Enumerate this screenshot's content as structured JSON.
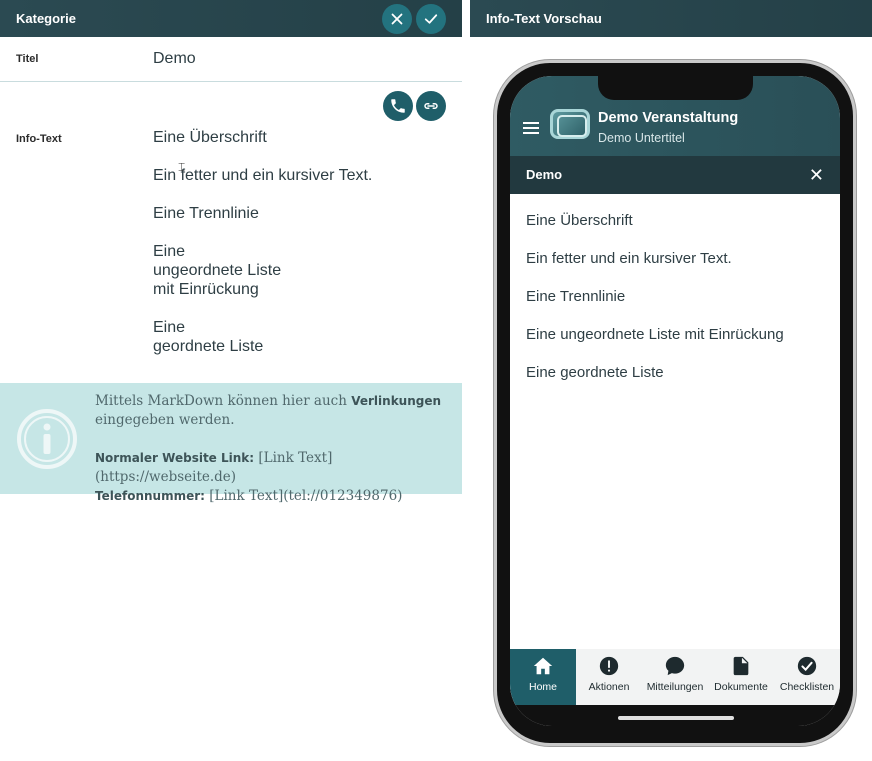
{
  "editor": {
    "header_title": "Kategorie",
    "cancel_icon": "close-icon",
    "confirm_icon": "check-icon",
    "title_label": "Titel",
    "title_value": "Demo",
    "infotext_label": "Info-Text",
    "tools": [
      "phone-icon",
      "link-icon"
    ],
    "infotext_blocks": [
      "Eine Überschrift",
      "Ein fetter und ein kursiver Text.",
      "Eine Trennlinie",
      "Eine\nungeordnete Liste\nmit Einrückung",
      "Eine\ngeordnete Liste"
    ],
    "hint": {
      "line1_pre": "Mittels MarkDown können hier auch ",
      "line1_bold": "Verlinkungen",
      "line1_post": " eingegeben werden.",
      "website_label": "Normaler Website Link:",
      "website_value": " [Link Text](https://webseite.de)",
      "phone_label": "Telefonnummer:",
      "phone_value": " [Link Text](tel://012349876)"
    }
  },
  "preview": {
    "header_title": "Info-Text Vorschau",
    "app_title": "Demo Veranstaltung",
    "app_subtitle": "Demo Untertitel",
    "section_title": "Demo",
    "close_glyph": "✕",
    "lines": [
      "Eine Überschrift",
      "Ein fetter und ein kursiver Text.",
      "Eine Trennlinie",
      "Eine ungeordnete Liste mit Einrückung",
      "Eine geordnete Liste"
    ],
    "nav": [
      {
        "label": "Home",
        "icon": "home-icon",
        "active": true
      },
      {
        "label": "Aktionen",
        "icon": "alert-icon",
        "active": false
      },
      {
        "label": "Mitteilungen",
        "icon": "chat-icon",
        "active": false
      },
      {
        "label": "Dokumente",
        "icon": "document-icon",
        "active": false
      },
      {
        "label": "Checklisten",
        "icon": "check-circle-icon",
        "active": false
      }
    ]
  },
  "colors": {
    "header": "#2b4a52",
    "accent": "#23737f",
    "hint_bg": "#c6e6e6",
    "nav_active": "#1f5e69"
  }
}
